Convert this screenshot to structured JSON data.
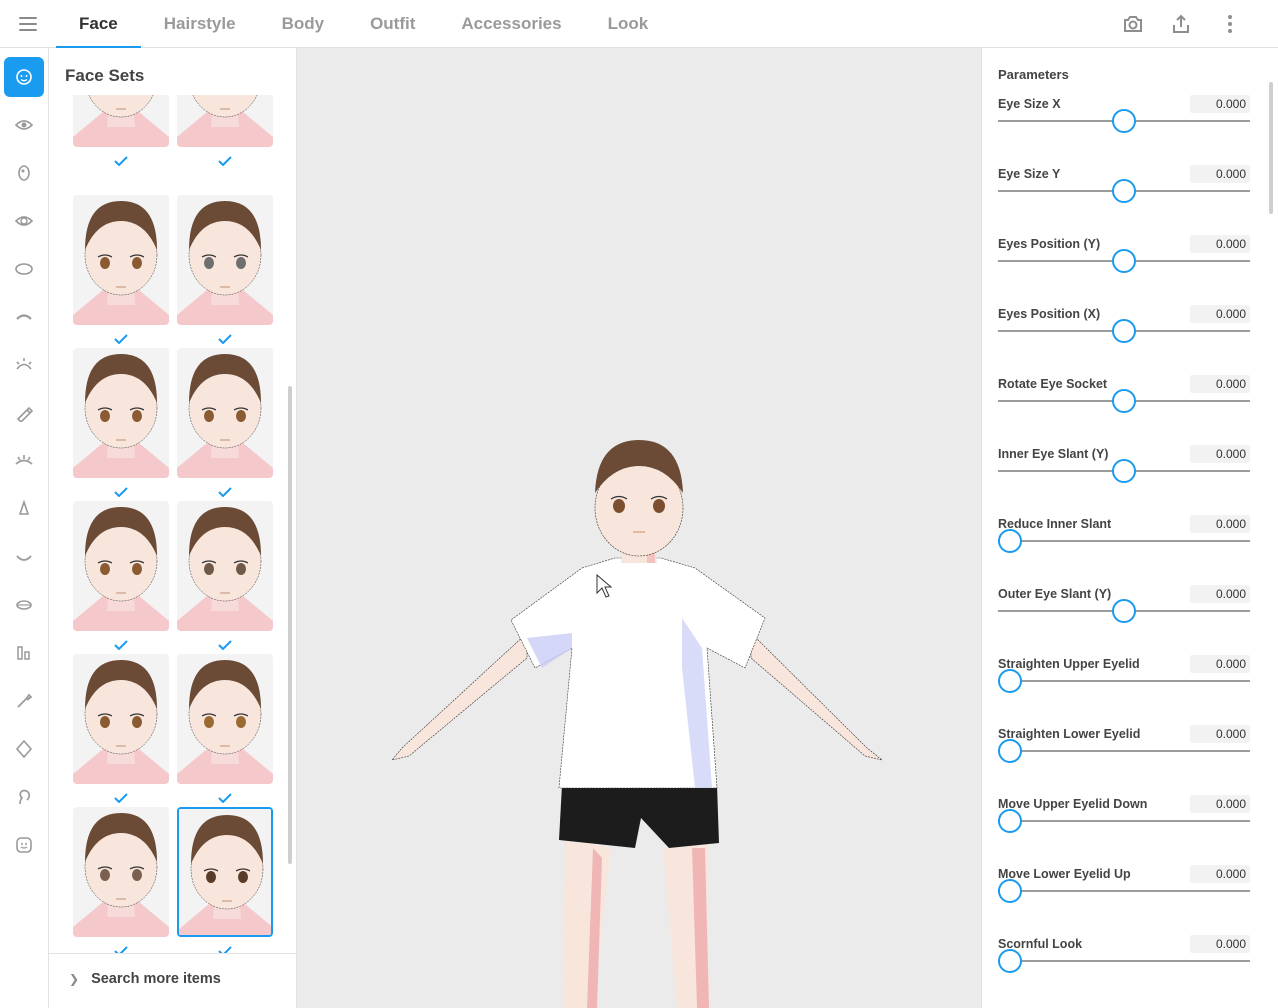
{
  "tabs": [
    {
      "label": "Face",
      "active": true
    },
    {
      "label": "Hairstyle",
      "active": false
    },
    {
      "label": "Body",
      "active": false
    },
    {
      "label": "Outfit",
      "active": false
    },
    {
      "label": "Accessories",
      "active": false
    },
    {
      "label": "Look",
      "active": false
    }
  ],
  "topbar_icons": [
    "menu-icon",
    "camera-icon",
    "share-icon",
    "more-vert-icon"
  ],
  "rail_icons": [
    "face-icon",
    "eye-icon",
    "iris-icon",
    "eye-highlight-icon",
    "eye-shape-icon",
    "eyebrow-icon",
    "eyelash-icon",
    "eyeliner-icon",
    "eyelid-icon",
    "nose-icon",
    "mouth-icon",
    "lips-icon",
    "teeth-icon",
    "brush-icon",
    "head-shape-icon",
    "ear-icon",
    "face-set-icon"
  ],
  "face_panel": {
    "title": "Face Sets",
    "selected_index": 11,
    "thumb_count": 12,
    "search_more": "Search more items"
  },
  "params_panel": {
    "title": "Parameters",
    "items": [
      {
        "label": "Eye Size X",
        "value": "0.000",
        "position": 0.5
      },
      {
        "label": "Eye Size Y",
        "value": "0.000",
        "position": 0.5
      },
      {
        "label": "Eyes Position (Y)",
        "value": "0.000",
        "position": 0.5
      },
      {
        "label": "Eyes Position (X)",
        "value": "0.000",
        "position": 0.5
      },
      {
        "label": "Rotate Eye Socket",
        "value": "0.000",
        "position": 0.5
      },
      {
        "label": "Inner Eye Slant (Y)",
        "value": "0.000",
        "position": 0.5
      },
      {
        "label": "Reduce Inner Slant",
        "value": "0.000",
        "position": 0
      },
      {
        "label": "Outer Eye Slant (Y)",
        "value": "0.000",
        "position": 0.5
      },
      {
        "label": "Straighten Upper Eyelid",
        "value": "0.000",
        "position": 0
      },
      {
        "label": "Straighten Lower Eyelid",
        "value": "0.000",
        "position": 0
      },
      {
        "label": "Move Upper Eyelid Down",
        "value": "0.000",
        "position": 0
      },
      {
        "label": "Move Lower Eyelid Up",
        "value": "0.000",
        "position": 0
      },
      {
        "label": "Scornful Look",
        "value": "0.000",
        "position": 0
      }
    ]
  },
  "colors": {
    "accent": "#1a9bf0",
    "viewport_bg": "#ebebeb",
    "hair": "#6b4a36",
    "skin": "#f8e6dc",
    "shirt": "#ffffff",
    "shorts": "#1c1c1c"
  }
}
